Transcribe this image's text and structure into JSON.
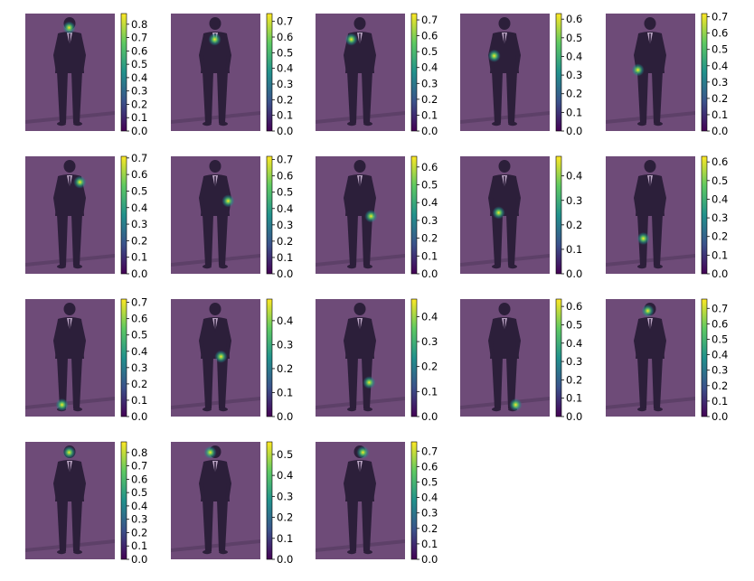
{
  "colormap": "viridis",
  "colors": {
    "overlay": "#6e4b78",
    "figure": "#2c1f3a",
    "colormap_stops": [
      "#440154",
      "#3b528b",
      "#21918c",
      "#5ec962",
      "#fde725"
    ]
  },
  "chart_data": [
    {
      "type": "heatmap",
      "panel": 1,
      "ticks": [
        "0.0",
        "0.1",
        "0.2",
        "0.3",
        "0.4",
        "0.5",
        "0.6",
        "0.7",
        "0.8"
      ],
      "vmax": 0.88,
      "hotspot": {
        "x": 0.49,
        "y": 0.12
      }
    },
    {
      "type": "heatmap",
      "panel": 2,
      "ticks": [
        "0.0",
        "0.1",
        "0.2",
        "0.3",
        "0.4",
        "0.5",
        "0.6",
        "0.7"
      ],
      "vmax": 0.75,
      "hotspot": {
        "x": 0.49,
        "y": 0.22
      }
    },
    {
      "type": "heatmap",
      "panel": 3,
      "ticks": [
        "0.0",
        "0.1",
        "0.2",
        "0.3",
        "0.4",
        "0.5",
        "0.6",
        "0.7"
      ],
      "vmax": 0.74,
      "hotspot": {
        "x": 0.4,
        "y": 0.22
      }
    },
    {
      "type": "heatmap",
      "panel": 4,
      "ticks": [
        "0.0",
        "0.1",
        "0.2",
        "0.3",
        "0.4",
        "0.5",
        "0.6"
      ],
      "vmax": 0.63,
      "hotspot": {
        "x": 0.38,
        "y": 0.36
      }
    },
    {
      "type": "heatmap",
      "panel": 5,
      "ticks": [
        "0.0",
        "0.1",
        "0.2",
        "0.3",
        "0.4",
        "0.5",
        "0.6",
        "0.7"
      ],
      "vmax": 0.72,
      "hotspot": {
        "x": 0.36,
        "y": 0.48
      }
    },
    {
      "type": "heatmap",
      "panel": 6,
      "ticks": [
        "0.0",
        "0.1",
        "0.2",
        "0.3",
        "0.4",
        "0.5",
        "0.6",
        "0.7"
      ],
      "vmax": 0.71,
      "hotspot": {
        "x": 0.61,
        "y": 0.22
      }
    },
    {
      "type": "heatmap",
      "panel": 7,
      "ticks": [
        "0.0",
        "0.1",
        "0.2",
        "0.3",
        "0.4",
        "0.5",
        "0.6",
        "0.7"
      ],
      "vmax": 0.72,
      "hotspot": {
        "x": 0.64,
        "y": 0.38
      }
    },
    {
      "type": "heatmap",
      "panel": 8,
      "ticks": [
        "0.0",
        "0.1",
        "0.2",
        "0.3",
        "0.4",
        "0.5",
        "0.6"
      ],
      "vmax": 0.66,
      "hotspot": {
        "x": 0.62,
        "y": 0.51
      }
    },
    {
      "type": "heatmap",
      "panel": 9,
      "ticks": [
        "0.0",
        "0.1",
        "0.2",
        "0.3",
        "0.4"
      ],
      "vmax": 0.48,
      "hotspot": {
        "x": 0.43,
        "y": 0.48
      }
    },
    {
      "type": "heatmap",
      "panel": 10,
      "ticks": [
        "0.0",
        "0.1",
        "0.2",
        "0.3",
        "0.4",
        "0.5",
        "0.6"
      ],
      "vmax": 0.63,
      "hotspot": {
        "x": 0.42,
        "y": 0.7
      }
    },
    {
      "type": "heatmap",
      "panel": 11,
      "ticks": [
        "0.0",
        "0.1",
        "0.2",
        "0.3",
        "0.4",
        "0.5",
        "0.6",
        "0.7"
      ],
      "vmax": 0.72,
      "hotspot": {
        "x": 0.41,
        "y": 0.9
      }
    },
    {
      "type": "heatmap",
      "panel": 12,
      "ticks": [
        "0.0",
        "0.1",
        "0.2",
        "0.3",
        "0.4"
      ],
      "vmax": 0.49,
      "hotspot": {
        "x": 0.56,
        "y": 0.49
      }
    },
    {
      "type": "heatmap",
      "panel": 13,
      "ticks": [
        "0.0",
        "0.1",
        "0.2",
        "0.3",
        "0.4"
      ],
      "vmax": 0.47,
      "hotspot": {
        "x": 0.6,
        "y": 0.71
      }
    },
    {
      "type": "heatmap",
      "panel": 14,
      "ticks": [
        "0.0",
        "0.1",
        "0.2",
        "0.3",
        "0.4",
        "0.5",
        "0.6"
      ],
      "vmax": 0.64,
      "hotspot": {
        "x": 0.62,
        "y": 0.9
      }
    },
    {
      "type": "heatmap",
      "panel": 15,
      "ticks": [
        "0.0",
        "0.1",
        "0.2",
        "0.3",
        "0.4",
        "0.5",
        "0.6",
        "0.7"
      ],
      "vmax": 0.76,
      "hotspot": {
        "x": 0.47,
        "y": 0.1
      }
    },
    {
      "type": "heatmap",
      "panel": 16,
      "ticks": [
        "0.0",
        "0.1",
        "0.2",
        "0.3",
        "0.4",
        "0.5",
        "0.6",
        "0.7",
        "0.8"
      ],
      "vmax": 0.88,
      "hotspot": {
        "x": 0.49,
        "y": 0.09
      }
    },
    {
      "type": "heatmap",
      "panel": 17,
      "ticks": [
        "0.0",
        "0.1",
        "0.2",
        "0.3",
        "0.4",
        "0.5"
      ],
      "vmax": 0.56,
      "hotspot": {
        "x": 0.44,
        "y": 0.09
      }
    },
    {
      "type": "heatmap",
      "panel": 18,
      "ticks": [
        "0.0",
        "0.1",
        "0.2",
        "0.3",
        "0.4",
        "0.5",
        "0.6",
        "0.7"
      ],
      "vmax": 0.76,
      "hotspot": {
        "x": 0.53,
        "y": 0.09
      }
    }
  ]
}
